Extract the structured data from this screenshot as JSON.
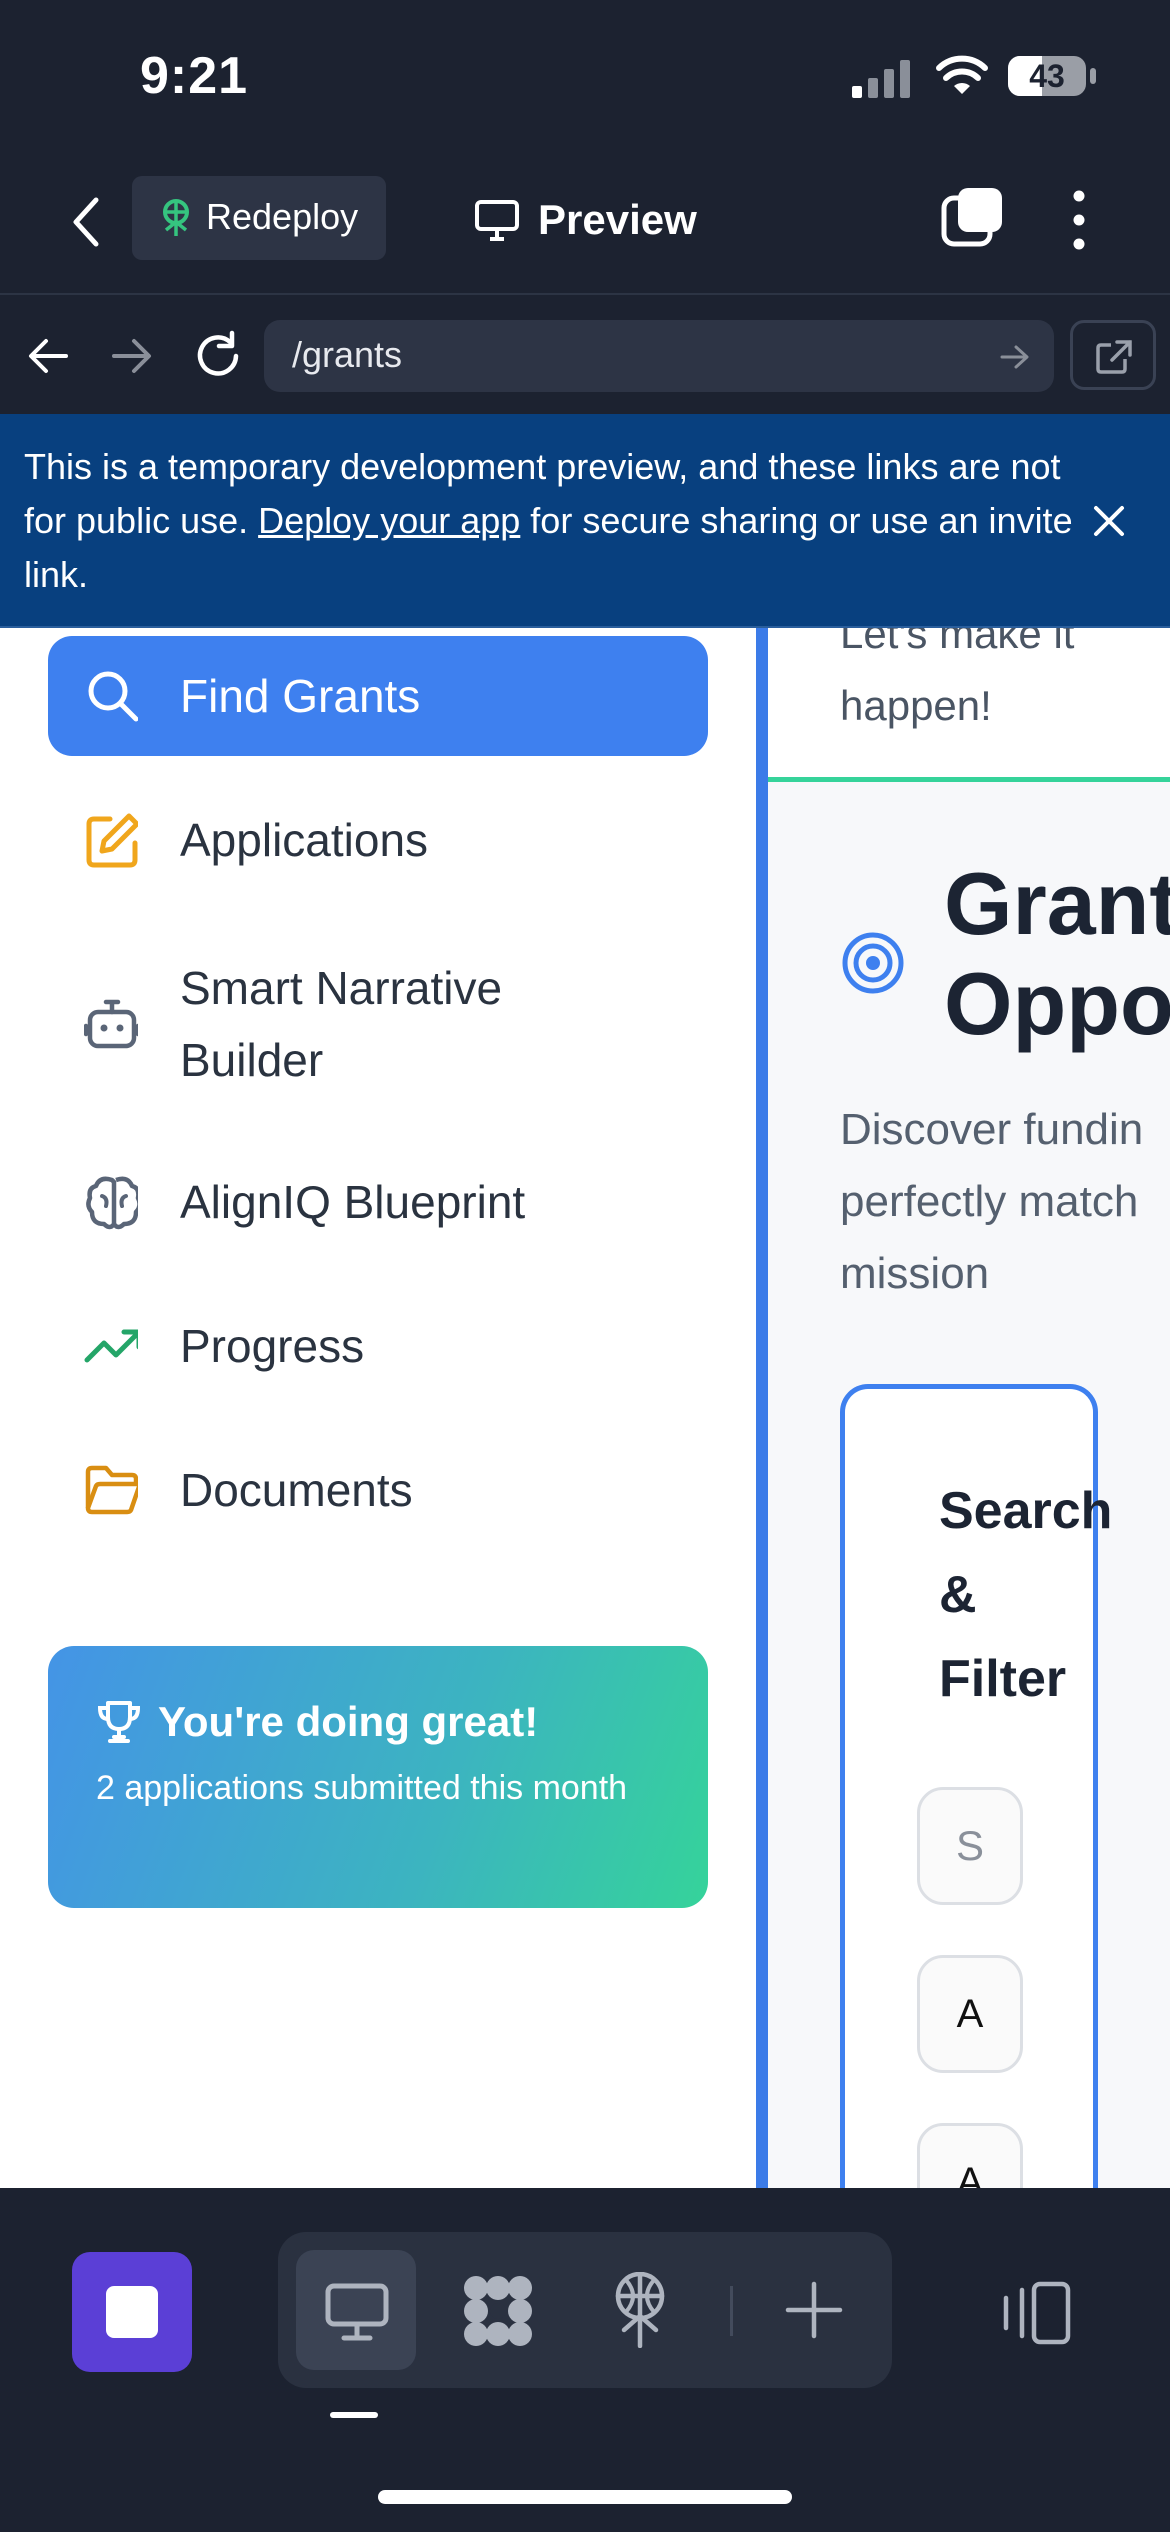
{
  "status_bar": {
    "time": "9:21",
    "battery": "43"
  },
  "toolbar": {
    "redeploy_label": "Redeploy",
    "preview_label": "Preview"
  },
  "browser": {
    "url": "/grants"
  },
  "banner": {
    "text_before": "This is a temporary development preview, and these links are not for public use. ",
    "link": "Deploy your app",
    "text_after": " for secure sharing or use an invite link."
  },
  "sidebar": {
    "items": [
      {
        "label": "Find Grants",
        "icon": "search-icon"
      },
      {
        "label": "Applications",
        "icon": "edit-icon"
      },
      {
        "label": "Smart Narrative Builder",
        "icon": "robot-icon"
      },
      {
        "label": "AlignIQ Blueprint",
        "icon": "brain-icon"
      },
      {
        "label": "Progress",
        "icon": "trending-up-icon"
      },
      {
        "label": "Documents",
        "icon": "folder-icon"
      }
    ],
    "promo": {
      "title": "You're doing great!",
      "subtitle": "2 applications submitted this month"
    }
  },
  "main": {
    "top_text_partial": "Let's make it",
    "top_text": "happen!",
    "heading_line1": "Grant",
    "heading_line2": "Oppo",
    "description_lines": [
      "Discover fundin",
      "perfectly match",
      "mission"
    ],
    "filter_title_lines": [
      "Search",
      "&",
      "Filter"
    ],
    "filter_chips": [
      "S",
      "A",
      "A"
    ]
  },
  "colors": {
    "accent": "#3e80ef",
    "banner": "#08407f",
    "dark": "#1c2230",
    "purple": "#5b3fd6",
    "green": "#35d39a"
  }
}
